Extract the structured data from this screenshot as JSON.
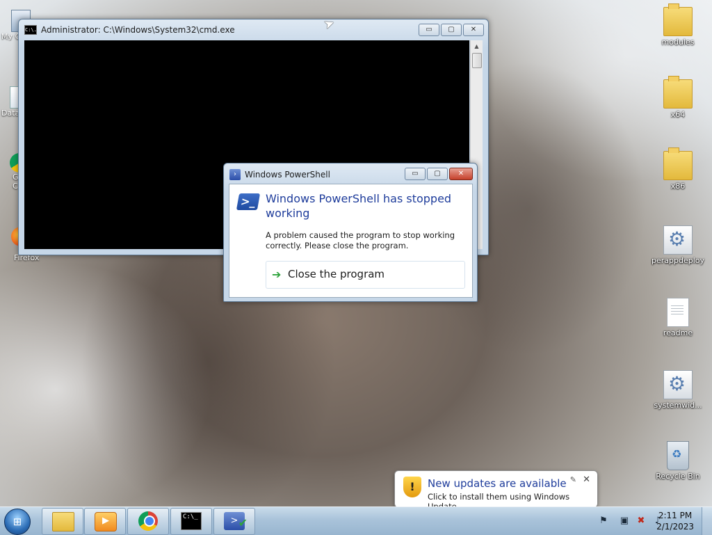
{
  "desktop": {
    "right_icons": [
      {
        "label": "modules",
        "icon": "folder-icon"
      },
      {
        "label": "x64",
        "icon": "folder-icon"
      },
      {
        "label": "x86",
        "icon": "folder-icon"
      },
      {
        "label": "perappdeploy",
        "icon": "config-file-icon"
      },
      {
        "label": "readme",
        "icon": "text-file-icon"
      },
      {
        "label": "systemwid...",
        "icon": "config-file-icon"
      },
      {
        "label": "Recycle Bin",
        "icon": "recycle-bin-icon"
      }
    ],
    "left_partial_icons": [
      {
        "label": "My C"
      },
      {
        "label": "Data"
      },
      {
        "label": "G\nC"
      },
      {
        "label": "Firefox"
      }
    ]
  },
  "cmd_window": {
    "title": "Administrator: C:\\Windows\\System32\\cmd.exe",
    "icon_text": "C:\\."
  },
  "error_dialog": {
    "title": "Windows PowerShell",
    "heading": "Windows PowerShell has stopped working",
    "message": "A problem caused the program to stop working correctly. Please close the program.",
    "action_label": "Close the program",
    "icon_glyph": ">_"
  },
  "caption_buttons": {
    "minimize": "▭",
    "maximize": "▢",
    "close": "✕"
  },
  "taskbar": {
    "start_glyph": "⊞",
    "pinned": [
      {
        "name": "windows-explorer",
        "glyph": ""
      },
      {
        "name": "media-player",
        "glyph": "▶"
      },
      {
        "name": "chrome",
        "glyph": ""
      },
      {
        "name": "command-prompt",
        "glyph": "C:\\_"
      },
      {
        "name": "powershell",
        "glyph": ">"
      }
    ],
    "clock_time": "2:11 PM",
    "clock_date": "2/1/2023"
  },
  "notification": {
    "title": "New updates are available",
    "text": "Click to install them using Windows Update.",
    "shield_glyph": "!"
  }
}
